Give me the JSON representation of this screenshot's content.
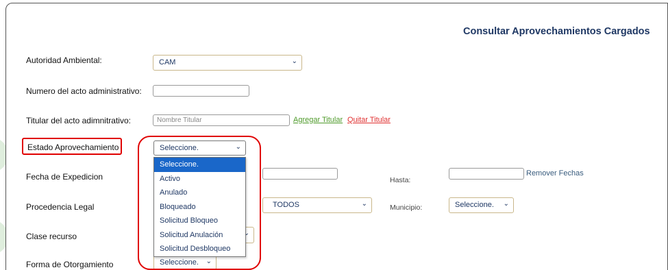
{
  "page": {
    "title": "Consultar Aprovechamientos Cargados"
  },
  "form": {
    "autoridad": {
      "label": "Autoridad Ambiental:",
      "value": "CAM"
    },
    "numero_acto": {
      "label": "Numero del acto administrativo:",
      "value": ""
    },
    "titular": {
      "label": "Titular del acto adimnitrativo:",
      "placeholder": "Nombre Titular",
      "add_link": "Agregar Titular",
      "remove_link": "Quitar Titular"
    },
    "estado": {
      "label": "Estado Aprovechamiento",
      "value": "Seleccione.",
      "options": [
        "Seleccione.",
        "Activo",
        "Anulado",
        "Bloqueado",
        "Solicitud Bloqueo",
        "Solicitud Anulación",
        "Solicitud Desbloqueo"
      ]
    },
    "fecha": {
      "label": "Fecha de Expedicion",
      "hasta_label": "Hasta:",
      "remove_link": "Remover Fechas"
    },
    "procedencia": {
      "label": "Procedencia Legal",
      "value": "TODOS",
      "municipio_label": "Municipio:",
      "municipio_value": "Seleccione."
    },
    "clase": {
      "label": "Clase recurso"
    },
    "forma": {
      "label": "Forma de Otorgamiento",
      "value": "Seleccione."
    }
  },
  "colors": {
    "title": "#1f3864",
    "highlight": "#e00000",
    "selected_option": "#1a67c9",
    "add_link": "#4e9a2a",
    "remove_link": "#e03030"
  }
}
